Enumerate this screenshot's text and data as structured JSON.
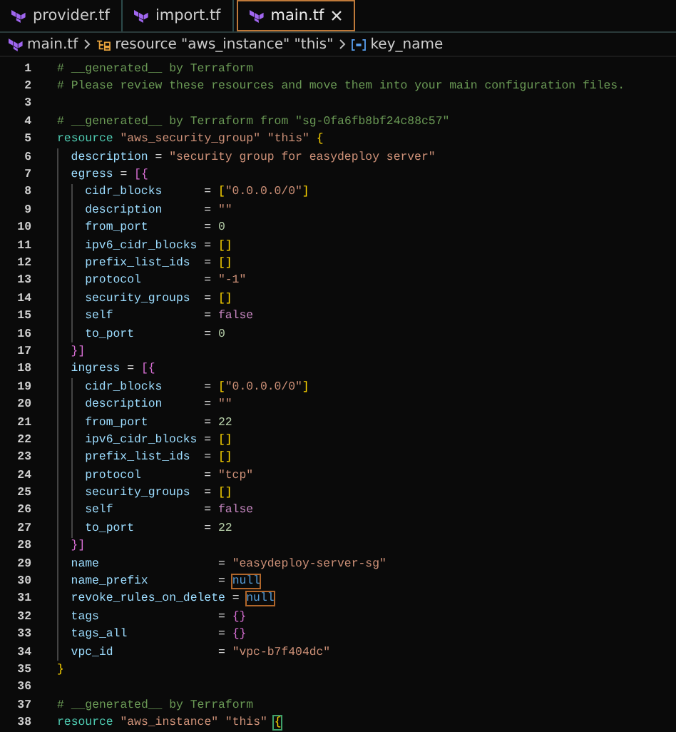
{
  "tabs": [
    {
      "label": "provider.tf",
      "selected": false,
      "closable": false
    },
    {
      "label": "import.tf",
      "selected": false,
      "closable": false
    },
    {
      "label": "main.tf",
      "selected": true,
      "closable": true
    }
  ],
  "breadcrumb": [
    {
      "kind": "file",
      "label": "main.tf"
    },
    {
      "kind": "resource",
      "label": "resource \"aws_instance\" \"this\""
    },
    {
      "kind": "field",
      "label": "key_name"
    }
  ],
  "lines": [
    {
      "number": "1",
      "tokens": [
        {
          "kind": "comment",
          "text": "# __generated__ by Terraform"
        }
      ]
    },
    {
      "number": "2",
      "tokens": [
        {
          "kind": "comment",
          "text": "# Please review these resources and move them into your main configuration files."
        }
      ]
    },
    {
      "number": "3"
    },
    {
      "number": "4",
      "tokens": [
        {
          "kind": "comment",
          "text": "# __generated__ by Terraform from \"sg-0fa6fb8bf24c88c57\""
        }
      ]
    },
    {
      "number": "5",
      "tokens": [
        {
          "kind": "keyword",
          "text": "resource "
        },
        {
          "kind": "string",
          "text": "\"aws_security_group\" \"this\" "
        },
        {
          "kind": "punct1",
          "text": "{"
        }
      ],
      "children": [
        {
          "number": "6",
          "tokens": [
            {
              "kind": "key",
              "text": "description"
            },
            {
              "kind": "op",
              "text": " = "
            },
            {
              "kind": "string",
              "text": "\"security group for easydeploy server\""
            }
          ]
        },
        {
          "number": "7",
          "tokens": [
            {
              "kind": "key",
              "text": "egress"
            },
            {
              "kind": "op",
              "text": " = "
            },
            {
              "kind": "punct2",
              "text": "[{"
            }
          ],
          "children": [
            {
              "number": "8",
              "tokens": [
                {
                  "kind": "key",
                  "text": "cidr_blocks      "
                },
                {
                  "kind": "op",
                  "text": "= "
                },
                {
                  "kind": "punct1",
                  "text": "["
                },
                {
                  "kind": "string",
                  "text": "\"0.0.0.0/0\""
                },
                {
                  "kind": "punct1",
                  "text": "]"
                }
              ]
            },
            {
              "number": "9",
              "tokens": [
                {
                  "kind": "key",
                  "text": "description      "
                },
                {
                  "kind": "op",
                  "text": "= "
                },
                {
                  "kind": "string",
                  "text": "\"\""
                }
              ]
            },
            {
              "number": "10",
              "tokens": [
                {
                  "kind": "key",
                  "text": "from_port        "
                },
                {
                  "kind": "op",
                  "text": "= "
                },
                {
                  "kind": "number",
                  "text": "0"
                }
              ]
            },
            {
              "number": "11",
              "tokens": [
                {
                  "kind": "key",
                  "text": "ipv6_cidr_blocks "
                },
                {
                  "kind": "op",
                  "text": "= "
                },
                {
                  "kind": "punct1",
                  "text": "[]"
                }
              ]
            },
            {
              "number": "12",
              "tokens": [
                {
                  "kind": "key",
                  "text": "prefix_list_ids  "
                },
                {
                  "kind": "op",
                  "text": "= "
                },
                {
                  "kind": "punct1",
                  "text": "[]"
                }
              ]
            },
            {
              "number": "13",
              "tokens": [
                {
                  "kind": "key",
                  "text": "protocol         "
                },
                {
                  "kind": "op",
                  "text": "= "
                },
                {
                  "kind": "string",
                  "text": "\"-1\""
                }
              ]
            },
            {
              "number": "14",
              "tokens": [
                {
                  "kind": "key",
                  "text": "security_groups  "
                },
                {
                  "kind": "op",
                  "text": "= "
                },
                {
                  "kind": "punct1",
                  "text": "[]"
                }
              ]
            },
            {
              "number": "15",
              "tokens": [
                {
                  "kind": "key",
                  "text": "self             "
                },
                {
                  "kind": "op",
                  "text": "= "
                },
                {
                  "kind": "bool",
                  "text": "false"
                }
              ]
            },
            {
              "number": "16",
              "tokens": [
                {
                  "kind": "key",
                  "text": "to_port          "
                },
                {
                  "kind": "op",
                  "text": "= "
                },
                {
                  "kind": "number",
                  "text": "0"
                }
              ]
            }
          ]
        },
        {
          "number": "17",
          "tokens": [
            {
              "kind": "punct2",
              "text": "}]"
            }
          ]
        },
        {
          "number": "18",
          "tokens": [
            {
              "kind": "key",
              "text": "ingress"
            },
            {
              "kind": "op",
              "text": " = "
            },
            {
              "kind": "punct2",
              "text": "[{"
            }
          ],
          "children": [
            {
              "number": "19",
              "tokens": [
                {
                  "kind": "key",
                  "text": "cidr_blocks      "
                },
                {
                  "kind": "op",
                  "text": "= "
                },
                {
                  "kind": "punct1",
                  "text": "["
                },
                {
                  "kind": "string",
                  "text": "\"0.0.0.0/0\""
                },
                {
                  "kind": "punct1",
                  "text": "]"
                }
              ]
            },
            {
              "number": "20",
              "tokens": [
                {
                  "kind": "key",
                  "text": "description      "
                },
                {
                  "kind": "op",
                  "text": "= "
                },
                {
                  "kind": "string",
                  "text": "\"\""
                }
              ]
            },
            {
              "number": "21",
              "tokens": [
                {
                  "kind": "key",
                  "text": "from_port        "
                },
                {
                  "kind": "op",
                  "text": "= "
                },
                {
                  "kind": "number",
                  "text": "22"
                }
              ]
            },
            {
              "number": "22",
              "tokens": [
                {
                  "kind": "key",
                  "text": "ipv6_cidr_blocks "
                },
                {
                  "kind": "op",
                  "text": "= "
                },
                {
                  "kind": "punct1",
                  "text": "[]"
                }
              ]
            },
            {
              "number": "23",
              "tokens": [
                {
                  "kind": "key",
                  "text": "prefix_list_ids  "
                },
                {
                  "kind": "op",
                  "text": "= "
                },
                {
                  "kind": "punct1",
                  "text": "[]"
                }
              ]
            },
            {
              "number": "24",
              "tokens": [
                {
                  "kind": "key",
                  "text": "protocol         "
                },
                {
                  "kind": "op",
                  "text": "= "
                },
                {
                  "kind": "string",
                  "text": "\"tcp\""
                }
              ]
            },
            {
              "number": "25",
              "tokens": [
                {
                  "kind": "key",
                  "text": "security_groups  "
                },
                {
                  "kind": "op",
                  "text": "= "
                },
                {
                  "kind": "punct1",
                  "text": "[]"
                }
              ]
            },
            {
              "number": "26",
              "tokens": [
                {
                  "kind": "key",
                  "text": "self             "
                },
                {
                  "kind": "op",
                  "text": "= "
                },
                {
                  "kind": "bool",
                  "text": "false"
                }
              ]
            },
            {
              "number": "27",
              "tokens": [
                {
                  "kind": "key",
                  "text": "to_port          "
                },
                {
                  "kind": "op",
                  "text": "= "
                },
                {
                  "kind": "number",
                  "text": "22"
                }
              ]
            }
          ]
        },
        {
          "number": "28",
          "tokens": [
            {
              "kind": "punct2",
              "text": "}]"
            }
          ]
        },
        {
          "number": "29",
          "tokens": [
            {
              "kind": "key",
              "text": "name                 "
            },
            {
              "kind": "op",
              "text": "= "
            },
            {
              "kind": "string",
              "text": "\"easydeploy-server-sg\""
            }
          ]
        },
        {
          "number": "30",
          "tokens": [
            {
              "kind": "key",
              "text": "name_prefix          "
            },
            {
              "kind": "op",
              "text": "= "
            },
            {
              "kind": "null",
              "text": "null",
              "highlighted": true
            }
          ]
        },
        {
          "number": "31",
          "tokens": [
            {
              "kind": "key",
              "text": "revoke_rules_on_delete "
            },
            {
              "kind": "op",
              "text": "= "
            },
            {
              "kind": "null",
              "text": "null",
              "highlighted": true
            }
          ]
        },
        {
          "number": "32",
          "tokens": [
            {
              "kind": "key",
              "text": "tags                 "
            },
            {
              "kind": "op",
              "text": "= "
            },
            {
              "kind": "punct2",
              "text": "{}"
            }
          ]
        },
        {
          "number": "33",
          "tokens": [
            {
              "kind": "key",
              "text": "tags_all             "
            },
            {
              "kind": "op",
              "text": "= "
            },
            {
              "kind": "punct2",
              "text": "{}"
            }
          ]
        },
        {
          "number": "34",
          "tokens": [
            {
              "kind": "key",
              "text": "vpc_id               "
            },
            {
              "kind": "op",
              "text": "= "
            },
            {
              "kind": "string",
              "text": "\"vpc-b7f404dc\""
            }
          ]
        }
      ]
    },
    {
      "number": "35",
      "tokens": [
        {
          "kind": "punct1",
          "text": "}"
        }
      ]
    },
    {
      "number": "36"
    },
    {
      "number": "37",
      "tokens": [
        {
          "kind": "comment",
          "text": "# __generated__ by Terraform"
        }
      ]
    },
    {
      "number": "38",
      "tokens": [
        {
          "kind": "keyword",
          "text": "resource "
        },
        {
          "kind": "string",
          "text": "\"aws_instance\" \"this\" "
        },
        {
          "kind": "punct1",
          "text": "{",
          "highlighted": true
        }
      ]
    }
  ]
}
